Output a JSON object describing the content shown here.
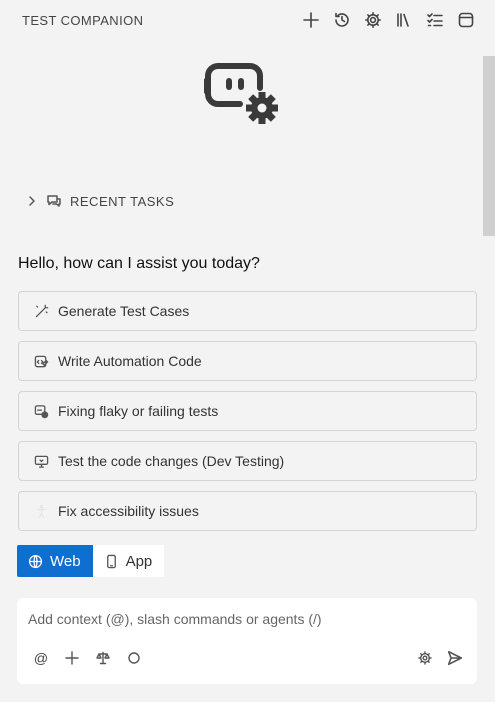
{
  "header": {
    "title": "TEST COMPANION",
    "actions": [
      "plus-icon",
      "history-icon",
      "gear-icon",
      "library-icon",
      "checklist-icon",
      "window-icon"
    ]
  },
  "logo": {
    "icon": "robot-gear-icon"
  },
  "recent_tasks": {
    "label": "RECENT TASKS",
    "icons": [
      "chevron-right-icon",
      "chat-icon"
    ]
  },
  "greeting": "Hello, how can I assist you today?",
  "suggestions": [
    {
      "label": "Generate Test Cases",
      "icon": "wand-icon"
    },
    {
      "label": "Write Automation Code",
      "icon": "code-edit-icon"
    },
    {
      "label": "Fixing flaky or failing tests",
      "icon": "bug-fix-icon"
    },
    {
      "label": "Test the code changes (Dev Testing)",
      "icon": "monitor-icon"
    },
    {
      "label": "Fix accessibility issues",
      "icon": "accessibility-icon"
    }
  ],
  "modes": {
    "web": {
      "label": "Web",
      "icon": "globe-icon",
      "selected": true
    },
    "app": {
      "label": "App",
      "icon": "phone-icon",
      "selected": false
    }
  },
  "composer": {
    "placeholder": "Add context (@), slash commands or agents (/)",
    "value": "",
    "tools": {
      "mention": "@"
    }
  },
  "colors": {
    "accent": "#0f6fd0",
    "background": "#f3f3f3"
  }
}
